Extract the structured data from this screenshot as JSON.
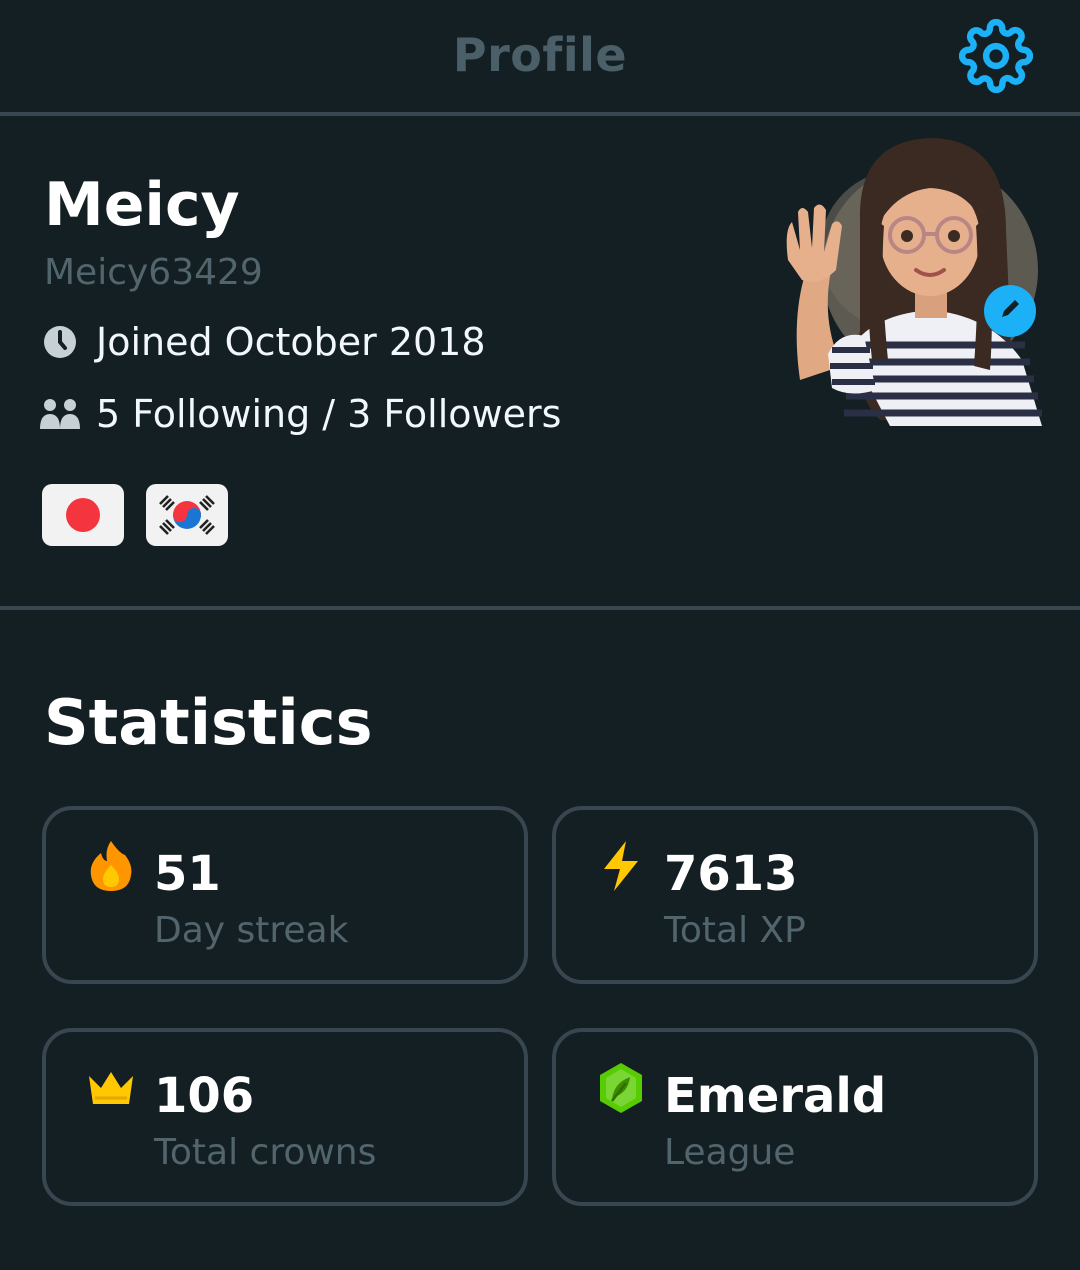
{
  "header": {
    "title": "Profile",
    "settings_icon": "gear-icon",
    "accent": "#1cb0f6"
  },
  "profile": {
    "display_name": "Meicy",
    "username": "Meicy63429",
    "joined": "Joined October 2018",
    "follow_text": "5 Following / 3 Followers",
    "flags": [
      {
        "name": "japan-flag"
      },
      {
        "name": "south-korea-flag"
      }
    ],
    "avatar_icon": "waving-avatar",
    "edit_icon": "pencil-icon"
  },
  "statistics": {
    "title": "Statistics",
    "cards": [
      {
        "value": "51",
        "label": "Day streak",
        "icon": "flame-icon",
        "color": "#ff9600"
      },
      {
        "value": "7613",
        "label": "Total XP",
        "icon": "lightning-icon",
        "color": "#ffc800"
      },
      {
        "value": "106",
        "label": "Total crowns",
        "icon": "crown-icon",
        "color": "#ffc800"
      },
      {
        "value": "Emerald",
        "label": "League",
        "icon": "emerald-league-icon",
        "color": "#58cc02"
      }
    ]
  }
}
